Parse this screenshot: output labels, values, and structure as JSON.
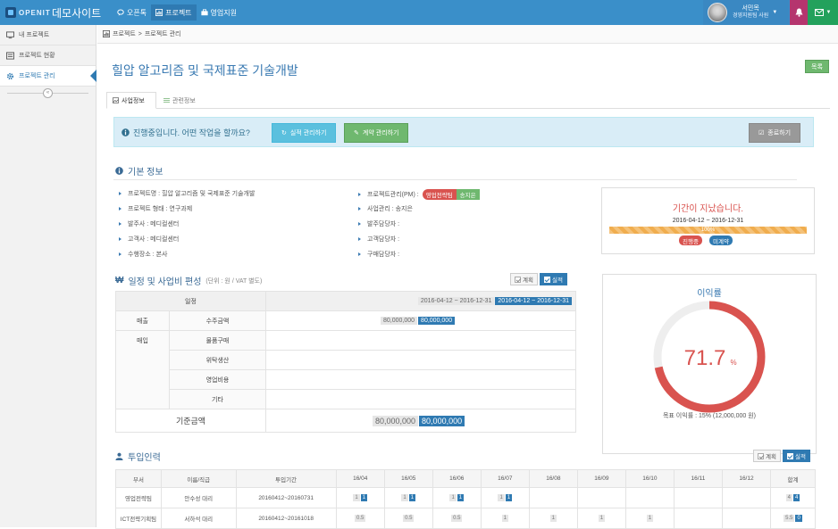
{
  "topbar": {
    "logo_text": "OPENIT",
    "site_title": "데모사이트",
    "nav": [
      {
        "label": "오픈톡",
        "icon": "chat-icon"
      },
      {
        "label": "프로젝트",
        "icon": "chart-icon"
      },
      {
        "label": "영업지원",
        "icon": "briefcase-icon"
      }
    ],
    "user_name": "서민목",
    "user_title": "경영지원팀 사원"
  },
  "sidebar": {
    "items": [
      {
        "label": "내 프로젝트",
        "icon": "monitor-icon"
      },
      {
        "label": "프로젝트 현황",
        "icon": "list-icon"
      },
      {
        "label": "프로젝트 관리",
        "icon": "gear-icon"
      }
    ]
  },
  "breadcrumb": {
    "root": "프로젝트",
    "sep": ">",
    "current": "프로젝트 관리"
  },
  "page": {
    "title": "힐압 알고리즘 및 국제표준 기술개발",
    "list_button": "목록"
  },
  "tabs": [
    "사업정보",
    "관련정보"
  ],
  "infobar": {
    "text": "진행중입니다. 어떤 작업을 할까요?",
    "btn_execution": "실적 관리하기",
    "btn_contract": "계약 관리하기",
    "btn_complete": "종료하기"
  },
  "basic": {
    "title": "기본 정보",
    "left": [
      "프로젝트명 : 힐압 알고리즘 및 국제표준 기술개발",
      "프로젝트 형태 : 연구과제",
      "발주사 : 메디컬센터",
      "고객사 : 메디컬센터",
      "수행장소 : 본사"
    ],
    "pm_label": "프로젝트관리(PM) :",
    "pm_tag1": "영업전략팀",
    "pm_tag2": "송지은",
    "right": [
      "사업관리 : 송지은",
      "발주담당자 :",
      "고객담당자 :",
      "구매담당자 :"
    ]
  },
  "period": {
    "message": "기간이 지났습니다.",
    "dates": "2016-04-12 ~ 2016-12-31",
    "progress_label": "100%",
    "progress": 100,
    "status1": "진행중",
    "status2": "미계약"
  },
  "budget": {
    "title": "일정 및 사업비 편성",
    "subtitle": "(단위 : 원 / VAT 별도)",
    "toggle_plan": "계획",
    "toggle_actual": "실적",
    "period_label": "일정",
    "period_plan": "2016-04-12 ~ 2016-12-31",
    "period_actual": "2016-04-12 ~ 2016-12-31",
    "sales_label": "매출",
    "purchase_label": "매입",
    "rows": [
      {
        "label": "수주금액",
        "plan": "80,000,000",
        "actual": "80,000,000"
      },
      {
        "label": "물품구매",
        "plan": "",
        "actual": ""
      },
      {
        "label": "위탁생산",
        "plan": "",
        "actual": ""
      },
      {
        "label": "영업비용",
        "plan": "",
        "actual": ""
      },
      {
        "label": "기타",
        "plan": "",
        "actual": ""
      }
    ],
    "total_label": "기준금액",
    "total_plan": "80,000,000",
    "total_actual": "80,000,000"
  },
  "profit": {
    "title": "이익률",
    "value": "71.7",
    "unit": "%",
    "percent": 71.7,
    "note": "목표 이익률 : 15% (12,000,000 원)",
    "color_fill": "#d9534f",
    "color_track": "#eeeeee"
  },
  "people": {
    "title": "투입인력",
    "toggle_plan": "계획",
    "toggle_actual": "실적",
    "headers": [
      "부서",
      "이름/직급",
      "투입기간",
      "16/04",
      "16/05",
      "16/06",
      "16/07",
      "16/08",
      "16/09",
      "16/10",
      "16/11",
      "16/12",
      "합계"
    ],
    "rows": [
      {
        "dept": "영업전략팀",
        "name": "안수성 대리",
        "period": "20160412~20160731",
        "months": [
          [
            "1",
            "1"
          ],
          [
            "1",
            "1"
          ],
          [
            "1",
            "1"
          ],
          [
            "1",
            "1"
          ],
          [],
          [],
          [],
          [],
          []
        ],
        "total": [
          "4",
          "4"
        ]
      },
      {
        "dept": "ICT전략기획팀",
        "name": "서하석 대리",
        "period": "20160412~20161018",
        "months": [
          [
            "0.5"
          ],
          [
            "0.5"
          ],
          [
            "0.5"
          ],
          [
            "1"
          ],
          [
            "1"
          ],
          [
            "1"
          ],
          [
            "1"
          ],
          [],
          []
        ],
        "total": [
          "5.5",
          "0"
        ]
      }
    ]
  },
  "colors": {
    "primary": "#3a8fc9",
    "accent_blue": "#2f7ab2",
    "danger": "#d9534f",
    "success": "#6fb86f",
    "warning": "#f0ad4e"
  }
}
